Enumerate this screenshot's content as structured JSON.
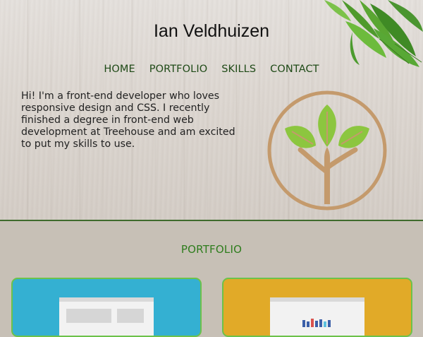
{
  "site": {
    "title": "Ian Veldhuizen"
  },
  "nav": {
    "items": [
      {
        "label": "HOME"
      },
      {
        "label": "PORTFOLIO"
      },
      {
        "label": "SKILLS"
      },
      {
        "label": "CONTACT"
      }
    ]
  },
  "intro": {
    "text": "Hi! I'm a front-end developer who loves responsive design and CSS. I recently finished a degree in front-end web development at Treehouse and am excited to put my skills to use."
  },
  "portfolio": {
    "heading": "PORTFOLIO",
    "cards": [
      {
        "icon": "layout-mockup",
        "background": "#34b0d2"
      },
      {
        "icon": "chart-mockup",
        "background": "#e1aa28"
      }
    ]
  },
  "colors": {
    "nav_text": "#1f4a17",
    "heading_green": "#2f7d1e",
    "card_border": "#6cc24a",
    "logo_tan": "#c49a6c",
    "leaf_green": "#8cc63f"
  }
}
